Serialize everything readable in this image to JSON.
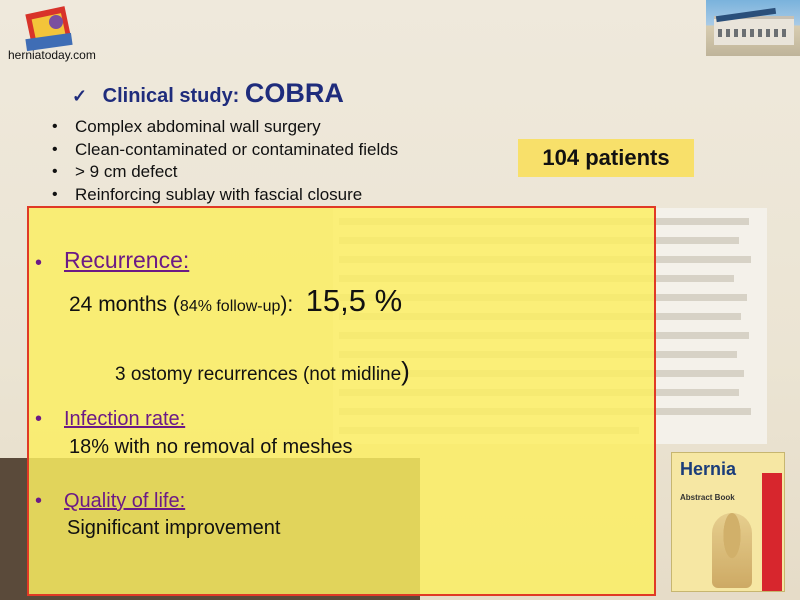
{
  "branding": {
    "site": "herniatoday.com"
  },
  "heading": {
    "check": "✓",
    "prefix": "Clinical study: ",
    "name": "COBRA"
  },
  "bullets": [
    "Complex abdominal wall surgery",
    "Clean-contaminated or contaminated fields",
    "> 9 cm defect",
    "Reinforcing sublay with fascial closure"
  ],
  "patients_badge": "104 patients",
  "results": {
    "recurrence": {
      "heading": "Recurrence:",
      "period": "24 months (",
      "followup": "84% follow-up",
      "close": "):",
      "rate": "15,5 %",
      "ostomy_text": "3 ostomy recurrences (not midline",
      "ostomy_close": ")"
    },
    "infection": {
      "heading": "Infection rate:",
      "detail": "18% with no removal of meshes"
    },
    "quality": {
      "heading": "Quality of life:",
      "detail": "Significant improvement"
    }
  },
  "journal": {
    "title": "Hernia",
    "subtitle": "Abstract Book"
  },
  "colors": {
    "heading_blue": "#1f2c7c",
    "overlay_yellow": "#fcee62",
    "overlay_border": "#e03a25",
    "subheading_purple": "#6c1a86",
    "badge_yellow": "#f8e06a"
  }
}
